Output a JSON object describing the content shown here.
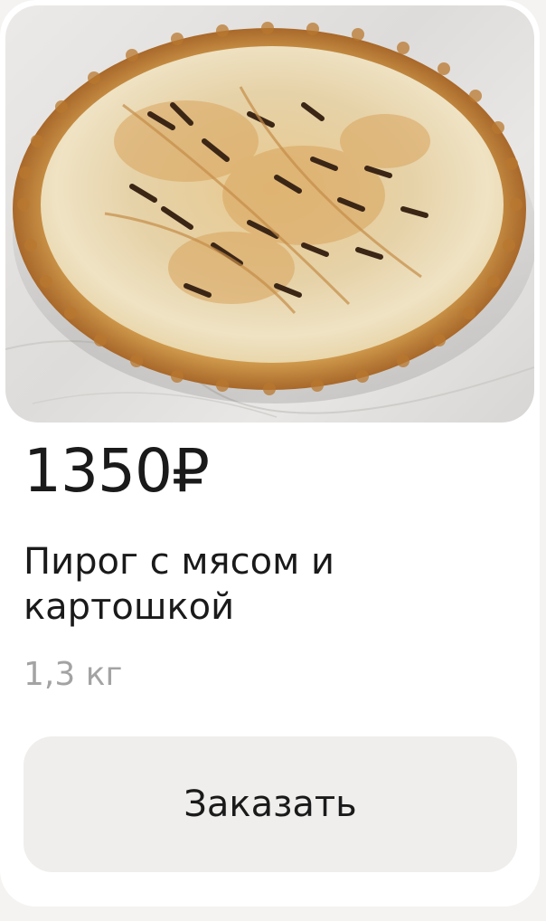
{
  "product": {
    "image_alt": "Пирог с мясом и картошкой",
    "price": "1350₽",
    "title": "Пирог с мясом и картошкой",
    "weight": "1,3 кг",
    "order_label": "Заказать"
  },
  "colors": {
    "card_bg": "#ffffff",
    "button_bg": "#efeeec",
    "text": "#1a1a1a",
    "muted": "#a3a3a3",
    "crust": "#c98a3e"
  }
}
